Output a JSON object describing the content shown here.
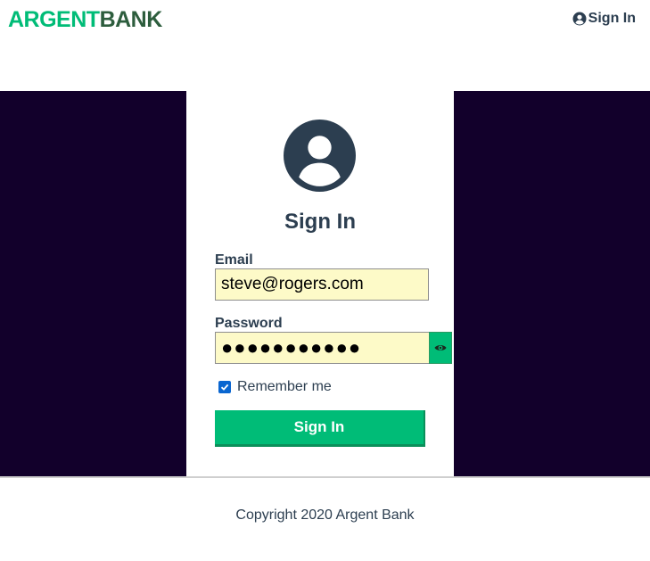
{
  "header": {
    "logo_part1": "ARGENT",
    "logo_part2": "BANK",
    "nav_signin_label": "Sign In",
    "nav_signin_icon": "user-circle-icon"
  },
  "form": {
    "avatar_icon": "user-circle-icon",
    "title": "Sign In",
    "email_label": "Email",
    "email_value": "steve@rogers.com",
    "password_label": "Password",
    "password_value": "●●●●●●●●●●●",
    "show_password_icon": "eye-icon",
    "remember_label": "Remember me",
    "remember_checked": true,
    "submit_label": "Sign In"
  },
  "footer": {
    "copyright": "Copyright 2020 Argent Bank"
  },
  "colors": {
    "accent_green": "#00bc77",
    "dark_green": "#2d5d3d",
    "background_dark": "#12002b",
    "input_bg": "#fdfac8",
    "text": "#2c3e50"
  }
}
